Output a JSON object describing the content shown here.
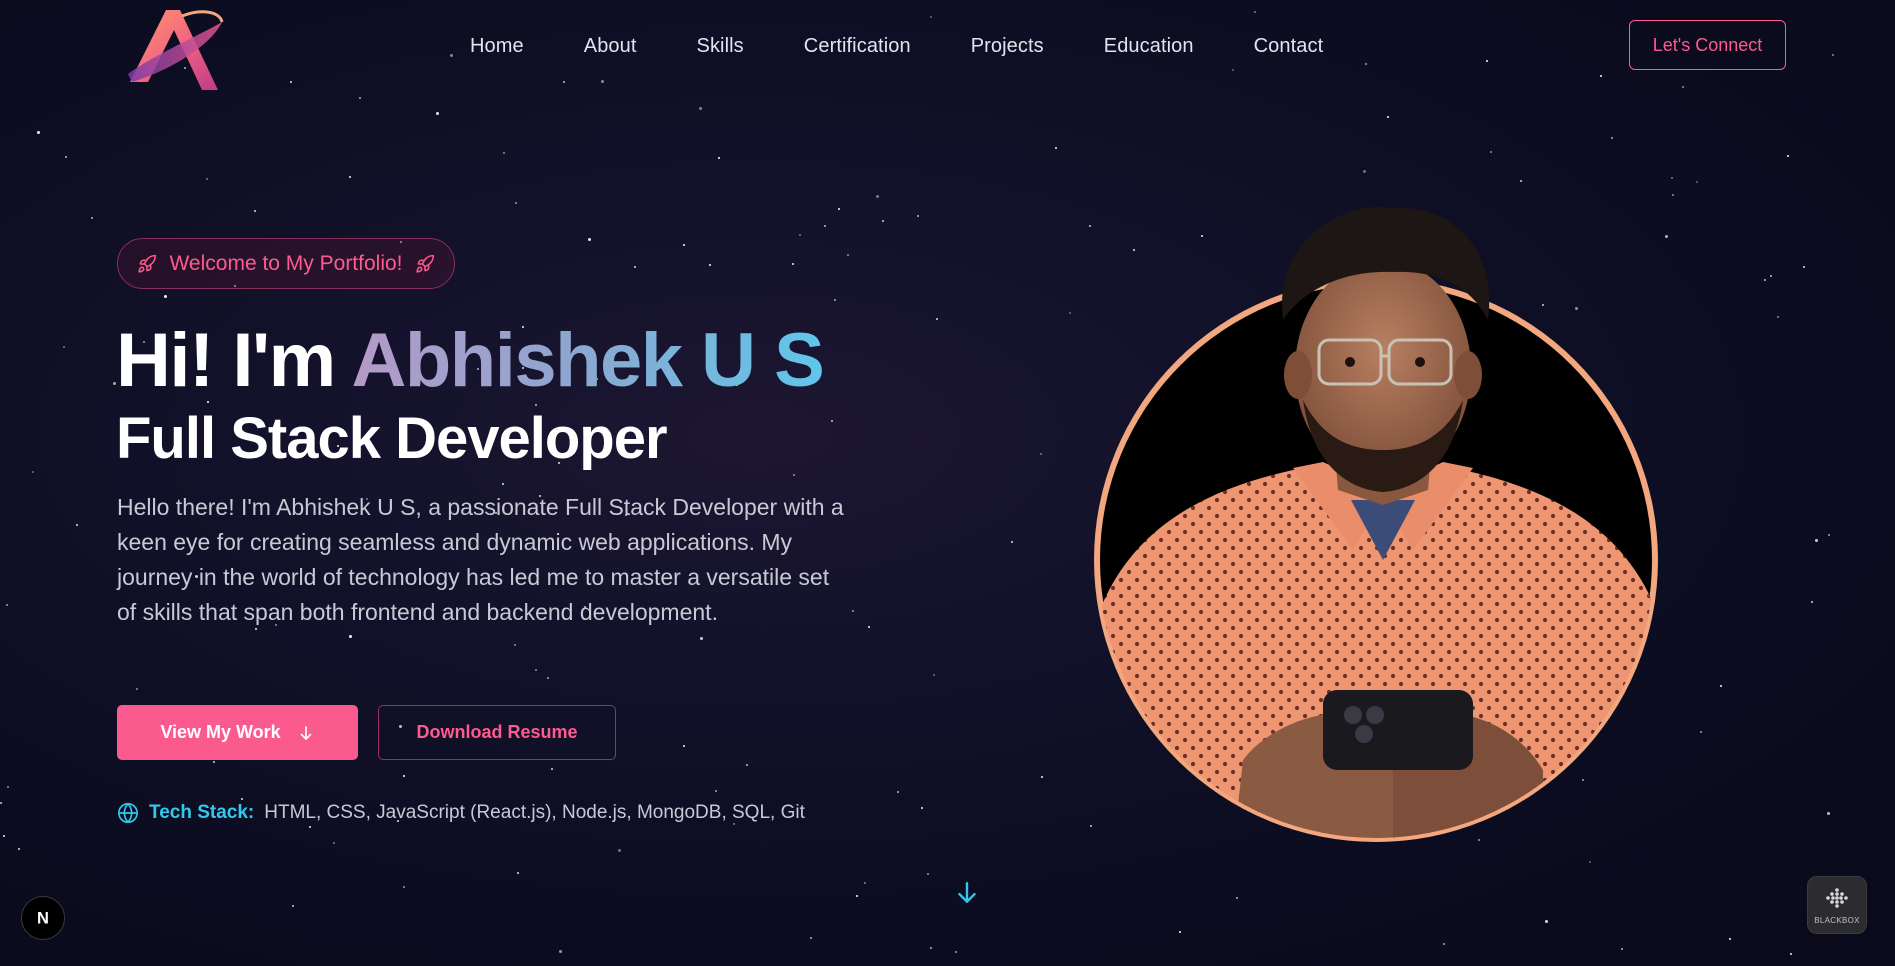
{
  "nav": {
    "items": [
      {
        "label": "Home"
      },
      {
        "label": "About"
      },
      {
        "label": "Skills"
      },
      {
        "label": "Certification"
      },
      {
        "label": "Projects"
      },
      {
        "label": "Education"
      },
      {
        "label": "Contact"
      }
    ],
    "cta_label": "Let's Connect"
  },
  "hero": {
    "badge_text": "Welcome to My Portfolio!",
    "greeting": "Hi! I'm ",
    "name": "Abhishek U S",
    "role": "Full Stack Developer",
    "description": "Hello there! I'm Abhishek U S, a passionate Full Stack Developer with a keen eye for creating seamless and dynamic web applications. My journey in the world of technology has led me to master a versatile set of skills that span both frontend and backend development.",
    "primary_button": "View My Work",
    "secondary_button": "Download Resume",
    "tech_label": "Tech Stack:",
    "tech_list": "HTML, CSS, JavaScript (React.js), Node.js, MongoDB, SQL, Git"
  },
  "widgets": {
    "next_badge": "N",
    "blackbox_label": "BLACKBOX"
  },
  "colors": {
    "accent_pink": "#fb5a8f",
    "accent_cyan": "#34c8ee",
    "background": "#0c0d22",
    "portrait_ring": "#f2a77e"
  },
  "icons": [
    "logo-icon",
    "rocket-icon",
    "arrow-down-icon",
    "globe-icon",
    "scroll-down-icon",
    "next-logo-icon",
    "blackbox-icon"
  ]
}
